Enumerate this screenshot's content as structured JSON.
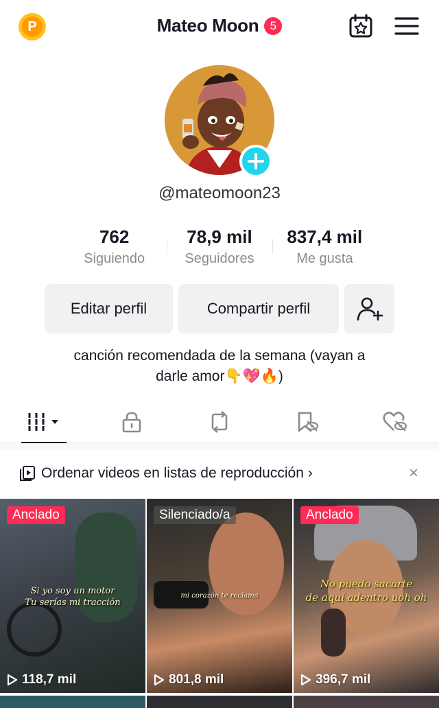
{
  "header": {
    "coin_letter": "P",
    "title": "Mateo Moon",
    "notification_count": "5"
  },
  "profile": {
    "handle": "@mateomoon23",
    "stats": [
      {
        "value": "762",
        "label": "Siguiendo"
      },
      {
        "value": "78,9 mil",
        "label": "Seguidores"
      },
      {
        "value": "837,4 mil",
        "label": "Me gusta"
      }
    ],
    "edit_label": "Editar perfil",
    "share_label": "Compartir perfil",
    "bio_line1": "canción recomendada de la semana (vayan a",
    "bio_line2": "darle amor👇💖🔥)"
  },
  "tabs": [
    {
      "icon": "grid-icon",
      "active": true
    },
    {
      "icon": "lock-icon",
      "active": false
    },
    {
      "icon": "repost-icon",
      "active": false
    },
    {
      "icon": "bookmark-hidden-icon",
      "active": false
    },
    {
      "icon": "heart-hidden-icon",
      "active": false
    }
  ],
  "playlist_banner": {
    "text": "Ordenar videos en listas de reproducción",
    "chevron": "›",
    "close": "×"
  },
  "videos": [
    {
      "tag": "Anclado",
      "caption_line1": "Si yo soy un motor",
      "caption_line2": "Tu serías mi tracción",
      "views": "118,7 mil"
    },
    {
      "tag": "Silenciado/a",
      "caption_line1": "mi corazón te reclama",
      "views": "801,8 mil"
    },
    {
      "tag": "Anclado",
      "caption_line1": "No puedo sacarte",
      "caption_line2": "de aquí adentro uoh oh",
      "views": "396,7 mil"
    }
  ],
  "colors": {
    "accent": "#fe2c55",
    "add_button": "#20d5ec",
    "coin": "#ffc21a"
  }
}
